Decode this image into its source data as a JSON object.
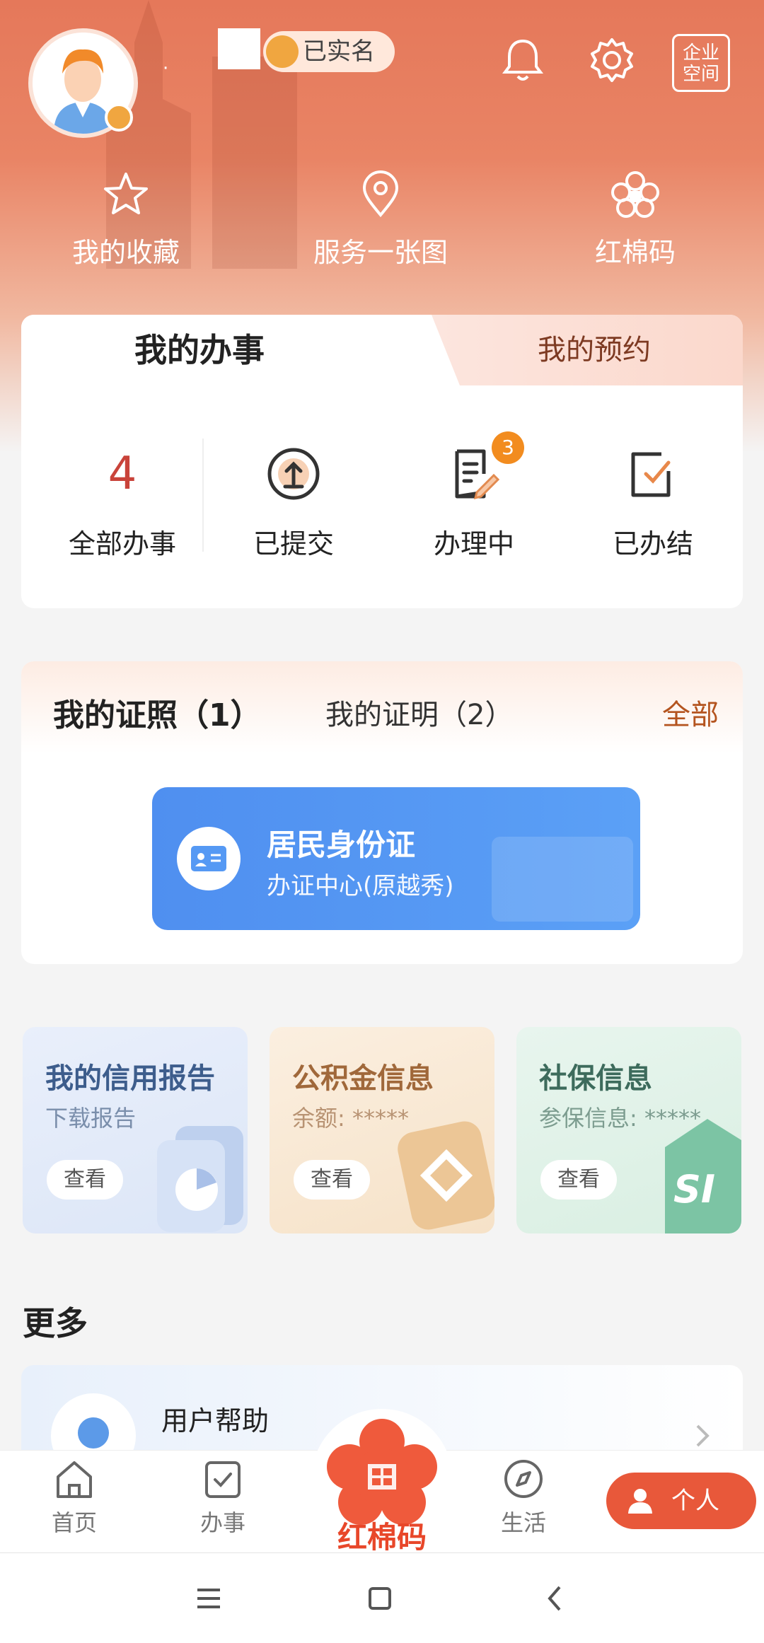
{
  "header": {
    "username": "·",
    "verified_label": "已实名",
    "enterprise_label": "企业空间"
  },
  "quick_actions": [
    {
      "label": "我的收藏",
      "icon": "star-icon"
    },
    {
      "label": "服务一张图",
      "icon": "location-pin-icon"
    },
    {
      "label": "红棉码",
      "icon": "kapok-flower-icon"
    }
  ],
  "affairs": {
    "tabs": [
      {
        "label": "我的办事"
      },
      {
        "label": "我的预约"
      }
    ],
    "total_count": "4",
    "items": [
      {
        "label": "全部办事"
      },
      {
        "label": "已提交",
        "icon": "upload-icon"
      },
      {
        "label": "办理中",
        "icon": "document-edit-icon",
        "badge": "3"
      },
      {
        "label": "已办结",
        "icon": "checked-box-icon"
      }
    ]
  },
  "licenses": {
    "tab_license": "我的证照（1）",
    "tab_proof": "我的证明（2）",
    "all_label": "全部",
    "id_card": {
      "title": "居民身份证",
      "subtitle": "办证中心(原越秀)"
    }
  },
  "tiles": [
    {
      "title": "我的信用报告",
      "subtitle": "下载报告",
      "button": "查看",
      "color": "#3d5d8c"
    },
    {
      "title": "公积金信息",
      "subtitle": "余额: *****",
      "button": "查看",
      "color": "#a0683a"
    },
    {
      "title": "社保信息",
      "subtitle": "参保信息: *****",
      "button": "查看",
      "color": "#3d6b5c"
    }
  ],
  "more": {
    "title": "更多",
    "help_label": "用户帮助"
  },
  "tabbar": {
    "home": "首页",
    "affairs": "办事",
    "code": "红棉码",
    "life": "生活",
    "personal": "个人"
  },
  "colors": {
    "primary": "#e8583a",
    "accent_orange": "#f28c1f",
    "card_blue": "#5599f4"
  }
}
